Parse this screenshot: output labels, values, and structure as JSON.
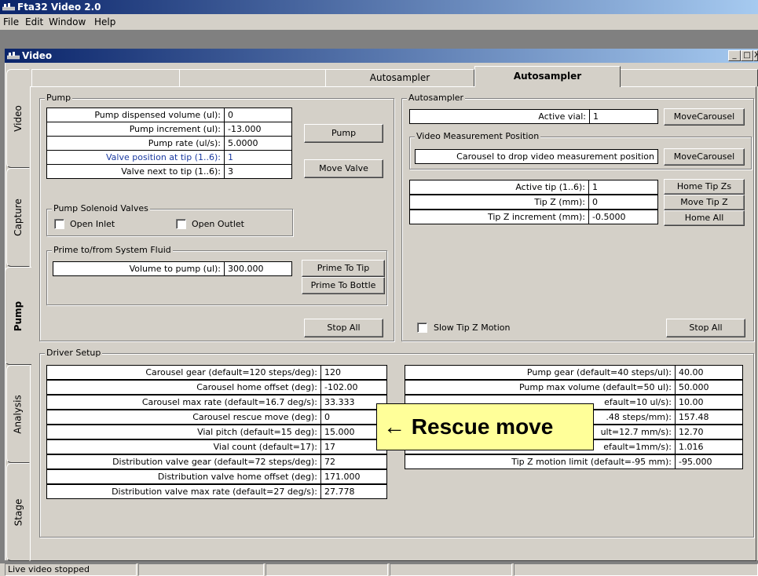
{
  "app": {
    "title": "Fta32 Video 2.0",
    "icon": "app-icon"
  },
  "menu": {
    "file": "File",
    "edit": "Edit",
    "window": "Window",
    "help": "Help"
  },
  "child": {
    "title": "Video",
    "minimize": "_",
    "maximize": "□",
    "close": "X"
  },
  "vtabs": {
    "video": "Video",
    "capture": "Capture",
    "pump": "Pump",
    "analysis": "Analysis",
    "stage": "Stage"
  },
  "htabs": {
    "tab1": "",
    "tab2": "",
    "tab3": "Autosampler",
    "tab4": ""
  },
  "pump": {
    "title": "Pump",
    "rows": [
      {
        "label": "Pump dispensed volume (ul):",
        "value": "0"
      },
      {
        "label": "Pump increment (ul):",
        "value": "-13.000"
      },
      {
        "label": "Pump rate (ul/s):",
        "value": "5.0000"
      },
      {
        "label": "Valve position at tip (1..6):",
        "value": "1"
      },
      {
        "label": "Valve next to tip (1..6):",
        "value": "3"
      }
    ],
    "pump_button": "Pump",
    "move_valve_button": "Move Valve",
    "solenoid_title": "Pump Solenoid Valves",
    "open_inlet": "Open Inlet",
    "open_outlet": "Open Outlet",
    "prime_title": "Prime to/from System Fluid",
    "volume_label": "Volume to pump (ul):",
    "volume_value": "300.000",
    "prime_tip": "Prime To Tip",
    "prime_bottle": "Prime To Bottle",
    "stop_all": "Stop All"
  },
  "autosampler": {
    "title": "Autosampler",
    "active_vial_label": "Active vial:",
    "active_vial_value": "1",
    "move_carousel": "MoveCarousel",
    "video_pos_title": "Video Measurement Position",
    "carousel_drop_label": "Carousel to drop video measurement position",
    "move_carousel2": "MoveCarousel",
    "tip_rows": [
      {
        "label": "Active tip (1..6):",
        "value": "1",
        "button": "Home Tip Zs"
      },
      {
        "label": "Tip Z (mm):",
        "value": "0",
        "button": "Move Tip Z"
      },
      {
        "label": "Tip Z increment (mm):",
        "value": "-0.5000",
        "button": "Home All"
      }
    ],
    "slow_motion": "Slow Tip Z Motion",
    "stop_all": "Stop All"
  },
  "driver": {
    "title": "Driver Setup",
    "left": [
      {
        "label": "Carousel gear (default=120 steps/deg):",
        "value": "120"
      },
      {
        "label": "Carousel home offset (deg):",
        "value": "-102.00"
      },
      {
        "label": "Carousel max rate (default=16.7 deg/s):",
        "value": "33.333"
      },
      {
        "label": "Carousel rescue move (deg):",
        "value": "0"
      },
      {
        "label": "Vial pitch (default=15 deg):",
        "value": "15.000"
      },
      {
        "label": "Vial count (default=17):",
        "value": "17"
      },
      {
        "label": "Distribution valve gear (default=72 steps/deg):",
        "value": "72"
      },
      {
        "label": "Distribution valve home offset (deg):",
        "value": "171.000"
      },
      {
        "label": "Distribution valve max rate (default=27 deg/s):",
        "value": "27.778"
      }
    ],
    "right": [
      {
        "label": "Pump gear (default=40 steps/ul):",
        "value": "40.00"
      },
      {
        "label": "Pump max volume (default=50 ul):",
        "value": "50.000"
      },
      {
        "label": "efault=10 ul/s):",
        "value": "10.00"
      },
      {
        "label": ".48 steps/mm):",
        "value": "157.48"
      },
      {
        "label": "ult=12.7 mm/s):",
        "value": "12.70"
      },
      {
        "label": "efault=1mm/s):",
        "value": "1.016"
      },
      {
        "label": "Tip Z motion limit (default=-95 mm):",
        "value": "-95.000"
      }
    ]
  },
  "callout": "← Rescue move",
  "status": {
    "text": "Live video stopped"
  }
}
